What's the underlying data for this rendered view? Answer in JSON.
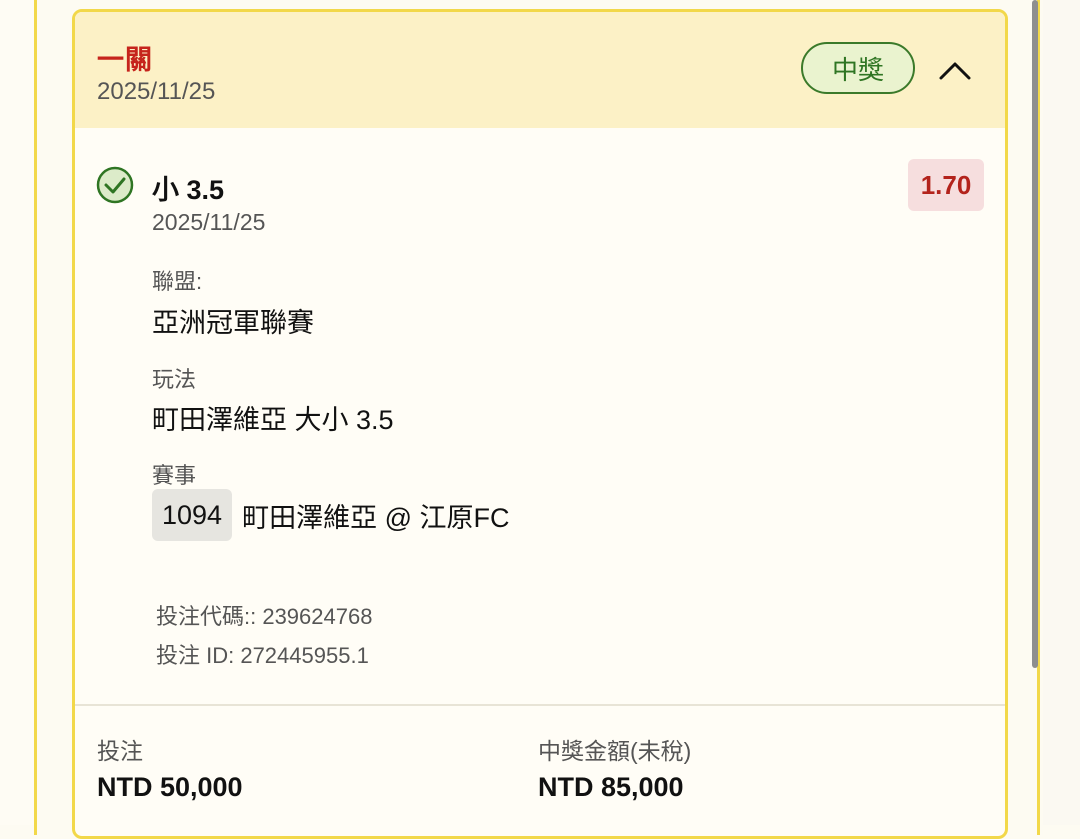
{
  "card": {
    "bet_type": "一關",
    "date": "2025/11/25",
    "status": "中獎"
  },
  "selection": {
    "name": "小 3.5",
    "date": "2025/11/25",
    "odds": "1.70"
  },
  "details": {
    "league_label": "聯盟:",
    "league_value": "亞洲冠軍聯賽",
    "play_label": "玩法",
    "play_value": "町田澤維亞 大小 3.5",
    "event_label": "賽事",
    "event_code": "1094",
    "event_name": "町田澤維亞 @ 江原FC"
  },
  "meta": {
    "bet_code": "投注代碼:: 239624768",
    "bet_id": "投注 ID: 272445955.1"
  },
  "footer": {
    "stake_label": "投注",
    "stake_value": "NTD 50,000",
    "payout_label": "中獎金額(未稅)",
    "payout_value": "NTD 85,000"
  },
  "icons": {
    "check": "check-circle-icon",
    "collapse": "chevron-up-icon"
  },
  "colors": {
    "accent_border": "#f2d84a",
    "header_bg": "#fcf1c6",
    "win_green": "#2f7523",
    "odds_red": "#b3231c"
  }
}
